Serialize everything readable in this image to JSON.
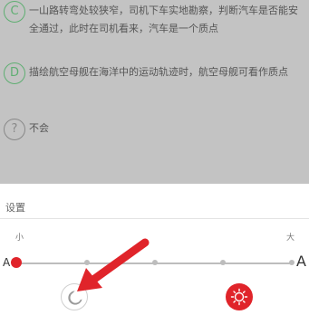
{
  "question": {
    "options": [
      {
        "letter": "C",
        "text": "一山路转弯处较狭窄，司机下车实地勘察，判断汽车是否能安全通过，此时在司机看来，汽车是一个质点"
      },
      {
        "letter": "D",
        "text": "描绘航空母舰在海洋中的运动轨迹时，航空母舰可看作质点"
      },
      {
        "letter": "?",
        "text": "不会"
      }
    ]
  },
  "settings": {
    "title": "设置",
    "font_size": {
      "small_label": "小",
      "large_label": "大",
      "min_glyph": "A",
      "max_glyph": "A",
      "level_fraction": 0.0
    },
    "modes": {
      "night_icon": "moon-icon",
      "day_icon": "sun-icon"
    }
  },
  "colors": {
    "accent_red": "#e0242a",
    "option_green": "#5fae72",
    "dim_overlay": "#c3c3c3"
  }
}
